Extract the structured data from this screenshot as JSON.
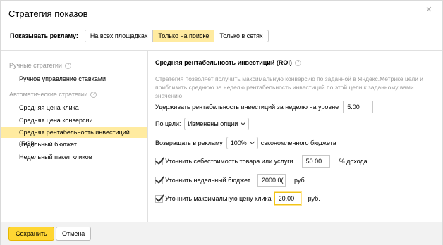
{
  "dialog": {
    "title": "Стратегия показов"
  },
  "show_ads": {
    "label": "Показывать рекламу:",
    "options": [
      "На всех площадках",
      "Только на поиске",
      "Только в сетях"
    ],
    "selected": "Только на поиске"
  },
  "sidebar": {
    "manual_group": "Ручные стратегии",
    "manual_items": [
      "Ручное управление ставками"
    ],
    "auto_group": "Автоматические стратегии",
    "auto_items": [
      "Средняя цена клика",
      "Средняя цена конверсии",
      "Средняя рентабельность инвестиций (ROI)",
      "Недельный бюджет",
      "Недельный пакет кликов"
    ],
    "selected": "Средняя рентабельность инвестиций (ROI)"
  },
  "strategy": {
    "heading": "Средняя рентабельность инвестиций (ROI)",
    "description": "Стратегия позволяет получить максимальную конверсию по заданной в Яндекс.Метрике цели и приблизить среднюю за неделю рентабельность инвестиций по этой цели к заданному вами значению",
    "keep_roi_label": "Удерживать рентабельность инвестиций за неделю на уровне",
    "keep_roi_value": "5.00",
    "goal_label": "По цели:",
    "goal_value": "Изменены опции",
    "return_label": "Возвращать в рекламу",
    "return_value": "100%",
    "return_suffix": "сэкономленного бюджета",
    "cost_label": "Уточнить себестоимость товара или услуги",
    "cost_value": "50.00",
    "cost_suffix": "% дохода",
    "budget_label": "Уточнить недельный бюджет",
    "budget_value": "2000.0(",
    "budget_suffix": "руб.",
    "maxprice_label": "Уточнить максимальную цену клика",
    "maxprice_value": "20.00",
    "maxprice_suffix": "руб."
  },
  "footer": {
    "save_label": "Сохранить",
    "cancel_label": "Отмена"
  }
}
